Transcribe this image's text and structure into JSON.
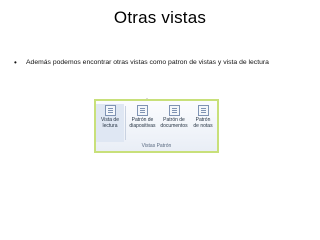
{
  "slide": {
    "title": "Otras vistas",
    "bullet": "Además podemos encontrar otras vistas como patron de vistas y vista de lectura"
  },
  "ribbon": {
    "buttons": [
      {
        "line1": "Vista de",
        "line2": "lectura",
        "icon": "reading-view-icon"
      },
      {
        "line1": "Patrón de",
        "line2": "diapositivas",
        "icon": "slide-master-icon"
      },
      {
        "line1": "Patrón de",
        "line2": "documentos",
        "icon": "handout-master-icon"
      },
      {
        "line1": "Patrón",
        "line2": "de notas",
        "icon": "notes-master-icon"
      }
    ],
    "group_label": "Vistas Patrón",
    "border_color": "#c8e07a"
  }
}
